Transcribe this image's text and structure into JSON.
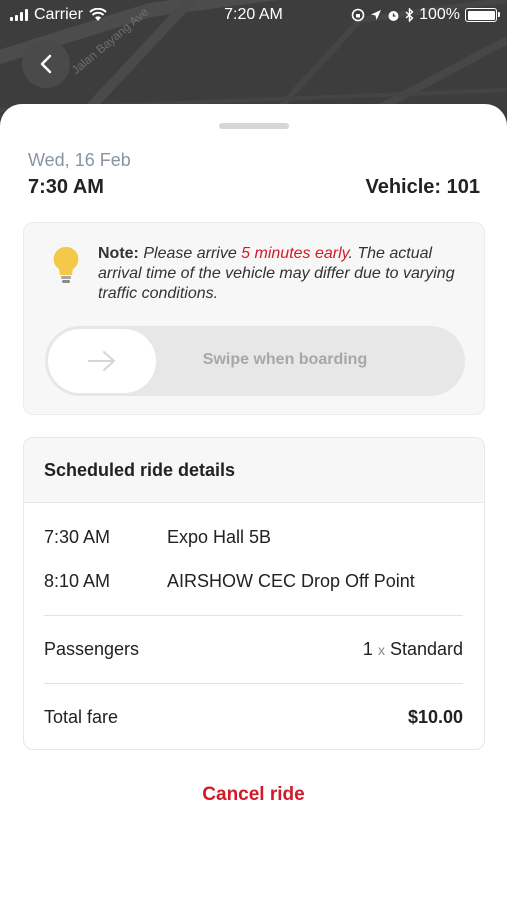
{
  "status_bar": {
    "carrier": "Carrier",
    "time": "7:20 AM",
    "battery": "100%"
  },
  "map": {
    "street_label": "Jalan Bayang Ave"
  },
  "ride": {
    "date": "Wed, 16 Feb",
    "time": "7:30 AM",
    "vehicle": "Vehicle: 101"
  },
  "note": {
    "label": "Note:",
    "text_before": "Please arrive",
    "highlight": "5 minutes early",
    "text_after": ". The actual arrival time of the vehicle may differ due to varying traffic conditions."
  },
  "swipe": {
    "label": "Swipe when boarding"
  },
  "details": {
    "heading": "Scheduled ride details",
    "stops": [
      {
        "time": "7:30 AM",
        "place": "Expo Hall 5B"
      },
      {
        "time": "8:10 AM",
        "place": "AIRSHOW CEC Drop Off Point"
      }
    ],
    "passengers_label": "Passengers",
    "passengers_count": "1",
    "passengers_x": "x",
    "passengers_type": "Standard",
    "fare_label": "Total fare",
    "fare_value": "$10.00"
  },
  "cancel_label": "Cancel ride",
  "colors": {
    "accent_red": "#d11a2a",
    "bulb_yellow": "#f5c84a"
  }
}
